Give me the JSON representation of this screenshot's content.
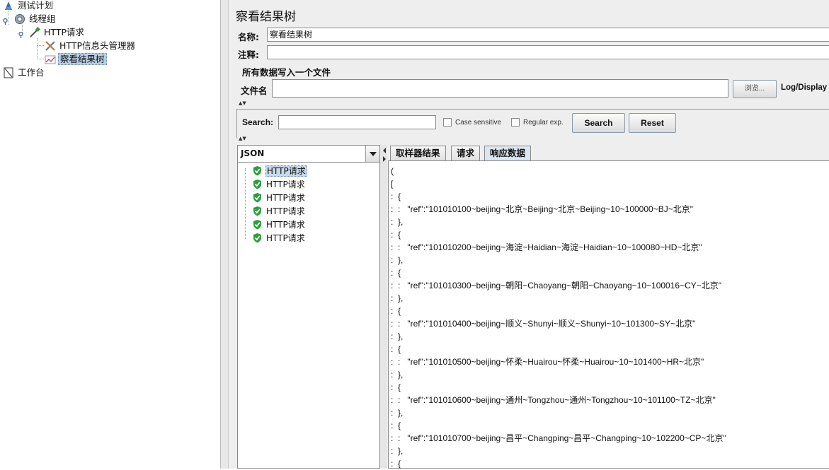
{
  "tree": {
    "test_plan": "测试计划",
    "thread_group": "线程组",
    "http_request": "HTTP请求",
    "header_manager": "HTTP信息头管理器",
    "result_tree": "察看结果树",
    "workbench": "工作台"
  },
  "panel": {
    "title": "察看结果树",
    "name_label": "名称:",
    "name_value": "察看结果树",
    "comment_label": "注释:",
    "comment_value": "",
    "file_section_title": "所有数据写入一个文件",
    "file_label": "文件名",
    "file_value": "",
    "browse_button": "浏览...",
    "log_display": "Log/Display"
  },
  "search": {
    "label": "Search:",
    "value": "",
    "case_sensitive": "Case sensitive",
    "regular_exp": "Regular exp.",
    "search_button": "Search",
    "reset_button": "Reset"
  },
  "results": {
    "renderer": "JSON",
    "items": [
      "HTTP请求",
      "HTTP请求",
      "HTTP请求",
      "HTTP请求",
      "HTTP请求",
      "HTTP请求"
    ],
    "status_color": "#2e9e3e"
  },
  "tabs": [
    {
      "label": "取样器结果"
    },
    {
      "label": "请求"
    },
    {
      "label": "响应数据"
    }
  ],
  "response_lines": [
    "(",
    "[",
    ":  {",
    ":  :   \"ref\":\"101010100~beijing~北京~Beijing~北京~Beijing~10~100000~BJ~北京\"",
    ":  },",
    ":  {",
    ":  :   \"ref\":\"101010200~beijing~海淀~Haidian~海淀~Haidian~10~100080~HD~北京\"",
    ":  },",
    ":  {",
    ":  :   \"ref\":\"101010300~beijing~朝阳~Chaoyang~朝阳~Chaoyang~10~100016~CY~北京\"",
    ":  },",
    ":  {",
    ":  :   \"ref\":\"101010400~beijing~顺义~Shunyi~顺义~Shunyi~10~101300~SY~北京\"",
    ":  },",
    ":  {",
    ":  :   \"ref\":\"101010500~beijing~怀柔~Huairou~怀柔~Huairou~10~101400~HR~北京\"",
    ":  },",
    ":  {",
    ":  :   \"ref\":\"101010600~beijing~通州~Tongzhou~通州~Tongzhou~10~101100~TZ~北京\"",
    ":  },",
    ":  {",
    ":  :   \"ref\":\"101010700~beijing~昌平~Changping~昌平~Changping~10~102200~CP~北京\"",
    ":  },",
    ":  {"
  ]
}
